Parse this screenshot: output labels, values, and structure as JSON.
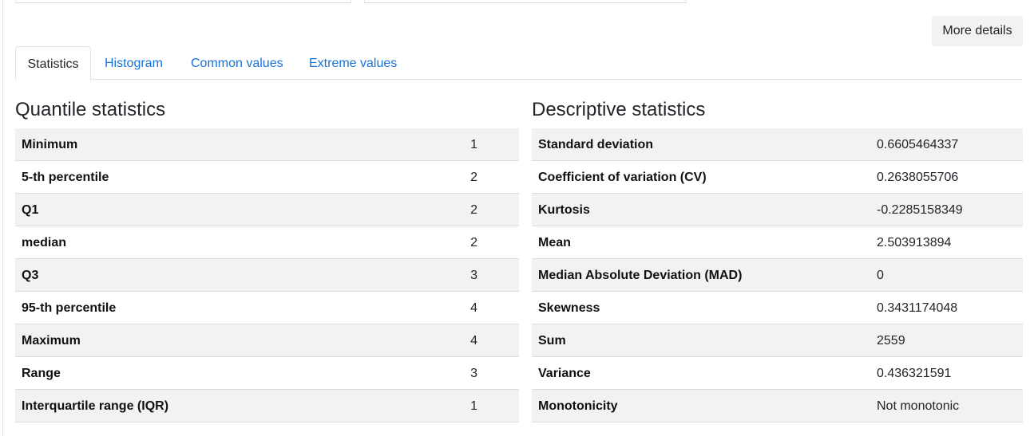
{
  "more_details_label": "More details",
  "tabs": [
    {
      "label": "Statistics",
      "active": true
    },
    {
      "label": "Histogram",
      "active": false
    },
    {
      "label": "Common values",
      "active": false
    },
    {
      "label": "Extreme values",
      "active": false
    }
  ],
  "quantile": {
    "title": "Quantile statistics",
    "rows": [
      {
        "label": "Minimum",
        "value": "1"
      },
      {
        "label": "5-th percentile",
        "value": "2"
      },
      {
        "label": "Q1",
        "value": "2"
      },
      {
        "label": "median",
        "value": "2"
      },
      {
        "label": "Q3",
        "value": "3"
      },
      {
        "label": "95-th percentile",
        "value": "4"
      },
      {
        "label": "Maximum",
        "value": "4"
      },
      {
        "label": "Range",
        "value": "3"
      },
      {
        "label": "Interquartile range (IQR)",
        "value": "1"
      }
    ]
  },
  "descriptive": {
    "title": "Descriptive statistics",
    "rows": [
      {
        "label": "Standard deviation",
        "value": "0.6605464337"
      },
      {
        "label": "Coefficient of variation (CV)",
        "value": "0.2638055706"
      },
      {
        "label": "Kurtosis",
        "value": "-0.2285158349"
      },
      {
        "label": "Mean",
        "value": "2.503913894"
      },
      {
        "label": "Median Absolute Deviation (MAD)",
        "value": "0"
      },
      {
        "label": "Skewness",
        "value": "0.3431174048"
      },
      {
        "label": "Sum",
        "value": "2559"
      },
      {
        "label": "Variance",
        "value": "0.436321591"
      },
      {
        "label": "Monotonicity",
        "value": "Not monotonic"
      }
    ]
  },
  "colors": {
    "link": "#1a73d9",
    "row_shaded": "#f2f2f2",
    "border": "#dcdcdc"
  }
}
